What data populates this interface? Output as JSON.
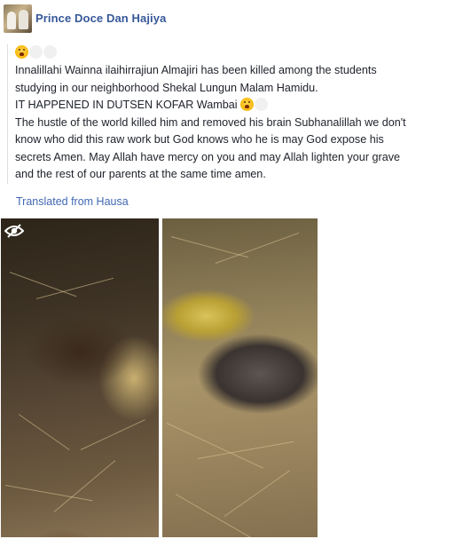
{
  "post": {
    "author": "Prince Doce Dan Hajiya",
    "emoji_name": "crying-face-emoji",
    "lines": [
      "Innalillahi Wainna ilaihirrajiun Almajiri has been killed among the students",
      "studying in our neighborhood Shekal Lungun Malam Hamidu.",
      "IT HAPPENED IN DUTSEN KOFAR Wambai",
      "The hustle of the world killed him and removed his brain Subhanalillah we don't",
      "know who did this raw work but God knows who he is may God expose his",
      "secrets Amen. May Allah have mercy on you and may Allah lighten your grave",
      "and the rest of our parents at the same time amen."
    ],
    "translated_link": "Translated from Hausa"
  },
  "colors": {
    "author": "#365899",
    "link": "#4267b2",
    "text": "#1d2129"
  },
  "media": {
    "left_photo_overlay_icon": "hidden-eye-icon"
  }
}
